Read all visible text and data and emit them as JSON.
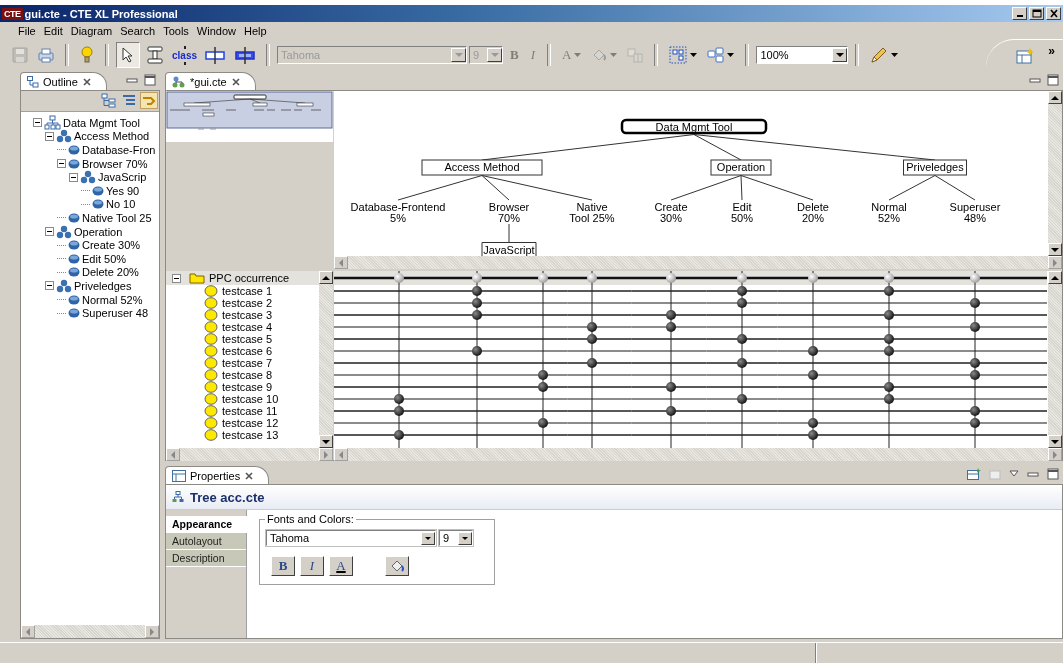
{
  "window": {
    "logo": "CTE",
    "title": "gui.cte - CTE XL Professional"
  },
  "menu": [
    {
      "label": "File"
    },
    {
      "label": "Edit"
    },
    {
      "label": "Diagram"
    },
    {
      "label": "Search"
    },
    {
      "label": "Tools"
    },
    {
      "label": "Window"
    },
    {
      "label": "Help"
    }
  ],
  "toolbar": {
    "groups": [
      [
        {
          "kind": "save",
          "disabled": true,
          "selected": false
        },
        {
          "kind": "print",
          "disabled": false,
          "selected": false
        }
      ],
      [
        {
          "kind": "hint",
          "disabled": false,
          "selected": false
        }
      ],
      [
        {
          "kind": "select",
          "disabled": false,
          "selected": true
        },
        {
          "kind": "classification",
          "disabled": false,
          "selected": false
        },
        {
          "kind": "class",
          "label": "class",
          "disabled": false,
          "selected": false
        },
        {
          "kind": "bar",
          "disabled": false,
          "selected": false
        },
        {
          "kind": "filledbar",
          "disabled": false,
          "selected": false
        }
      ],
      [
        {
          "kind": "font",
          "value": "Tahoma",
          "disabled": true,
          "selected": false
        },
        {
          "kind": "size",
          "value": "9",
          "disabled": true,
          "selected": false
        },
        {
          "kind": "bold",
          "label": "B",
          "disabled": true,
          "selected": false
        },
        {
          "kind": "italic",
          "label": "I",
          "disabled": true,
          "selected": false
        }
      ],
      [
        {
          "kind": "color",
          "label": "A",
          "disabled": true,
          "selected": false
        },
        {
          "kind": "fill",
          "disabled": true,
          "selected": false
        },
        {
          "kind": "format",
          "disabled": true,
          "selected": false
        }
      ],
      [
        {
          "kind": "layout",
          "disabled": false,
          "selected": false
        },
        {
          "kind": "group",
          "disabled": false,
          "selected": false
        }
      ],
      [
        {
          "kind": "zoom",
          "value": "100%",
          "disabled": false,
          "selected": false
        }
      ],
      [
        {
          "kind": "pen",
          "disabled": false,
          "selected": false
        }
      ]
    ],
    "chevron": "»"
  },
  "outline": {
    "tab": "Outline",
    "tree": [
      {
        "label": "Data Mgmt Tool",
        "kind": "tree",
        "expanded": true,
        "children": [
          {
            "label": "Access Method",
            "kind": "classification",
            "expanded": true,
            "children": [
              {
                "label": "Database-Fron",
                "kind": "class"
              },
              {
                "label": "Browser 70%",
                "kind": "class",
                "expanded": true,
                "children": [
                  {
                    "label": "JavaScrip",
                    "kind": "classification",
                    "expanded": true,
                    "children": [
                      {
                        "label": "Yes 90",
                        "kind": "class"
                      },
                      {
                        "label": "No 10",
                        "kind": "class"
                      }
                    ]
                  }
                ]
              },
              {
                "label": "Native Tool 25",
                "kind": "class"
              }
            ]
          },
          {
            "label": "Operation",
            "kind": "classification",
            "expanded": true,
            "children": [
              {
                "label": "Create 30%",
                "kind": "class"
              },
              {
                "label": "Edit 50%",
                "kind": "class"
              },
              {
                "label": "Delete 20%",
                "kind": "class"
              }
            ]
          },
          {
            "label": "Priveledges",
            "kind": "classification",
            "expanded": true,
            "children": [
              {
                "label": "Normal 52%",
                "kind": "class"
              },
              {
                "label": "Superuser 48",
                "kind": "class"
              }
            ]
          }
        ]
      }
    ]
  },
  "editor": {
    "tab": "*gui.cte",
    "diagram": {
      "root": "Data Mgmt Tool",
      "classifications": [
        {
          "label": "Access Method",
          "classes": [
            {
              "lines": [
                "Database-Frontend",
                "5%"
              ]
            },
            {
              "lines": [
                "Browser",
                "70%"
              ],
              "classifications": [
                {
                  "label": "JavaScript"
                }
              ]
            },
            {
              "lines": [
                "Native",
                "Tool 25%"
              ]
            }
          ]
        },
        {
          "label": "Operation",
          "classes": [
            {
              "lines": [
                "Create",
                "30%"
              ]
            },
            {
              "lines": [
                "Edit",
                "50%"
              ]
            },
            {
              "lines": [
                "Delete",
                "20%"
              ]
            }
          ]
        },
        {
          "label": "Priveledges",
          "classes": [
            {
              "lines": [
                "Normal",
                "52%"
              ]
            },
            {
              "lines": [
                "Superuser",
                "48%"
              ]
            }
          ]
        }
      ]
    },
    "testcases": {
      "header": "PPC occurrence",
      "expanded": true,
      "rows": [
        {
          "label": "testcase 1",
          "marked": [
            false,
            true,
            false,
            false,
            false,
            true,
            false,
            true,
            false
          ]
        },
        {
          "label": "testcase 2",
          "marked": [
            false,
            true,
            false,
            false,
            false,
            true,
            false,
            false,
            true
          ]
        },
        {
          "label": "testcase 3",
          "marked": [
            false,
            true,
            false,
            false,
            true,
            false,
            false,
            true,
            false
          ]
        },
        {
          "label": "testcase 4",
          "marked": [
            false,
            false,
            false,
            true,
            true,
            false,
            false,
            false,
            true
          ]
        },
        {
          "label": "testcase 5",
          "marked": [
            false,
            false,
            false,
            true,
            false,
            true,
            false,
            true,
            false
          ]
        },
        {
          "label": "testcase 6",
          "marked": [
            false,
            true,
            false,
            false,
            false,
            false,
            true,
            true,
            false
          ]
        },
        {
          "label": "testcase 7",
          "marked": [
            false,
            false,
            false,
            true,
            false,
            true,
            false,
            false,
            true
          ]
        },
        {
          "label": "testcase 8",
          "marked": [
            false,
            false,
            true,
            false,
            false,
            false,
            true,
            false,
            true
          ]
        },
        {
          "label": "testcase 9",
          "marked": [
            false,
            false,
            true,
            false,
            true,
            false,
            false,
            true,
            false
          ]
        },
        {
          "label": "testcase 10",
          "marked": [
            true,
            false,
            false,
            false,
            false,
            true,
            false,
            true,
            false
          ]
        },
        {
          "label": "testcase 11",
          "marked": [
            true,
            false,
            false,
            false,
            true,
            false,
            false,
            false,
            true
          ]
        },
        {
          "label": "testcase 12",
          "marked": [
            false,
            false,
            true,
            false,
            false,
            false,
            true,
            false,
            true
          ]
        },
        {
          "label": "testcase 13",
          "marked": [
            true,
            false,
            false,
            false,
            false,
            false,
            true,
            false,
            false
          ]
        }
      ]
    }
  },
  "properties": {
    "tab": "Properties",
    "title": "Tree acc.cte",
    "sections": [
      {
        "label": "Appearance",
        "selected": true
      },
      {
        "label": "Autolayout",
        "selected": false
      },
      {
        "label": "Description",
        "selected": false
      }
    ],
    "group_label": "Fonts and Colors:",
    "font": "Tahoma",
    "size": "9",
    "buttons": [
      {
        "kind": "bold",
        "label": "B"
      },
      {
        "kind": "italic",
        "label": "I"
      },
      {
        "kind": "color",
        "label": "A"
      },
      {
        "kind": "fill"
      }
    ]
  }
}
